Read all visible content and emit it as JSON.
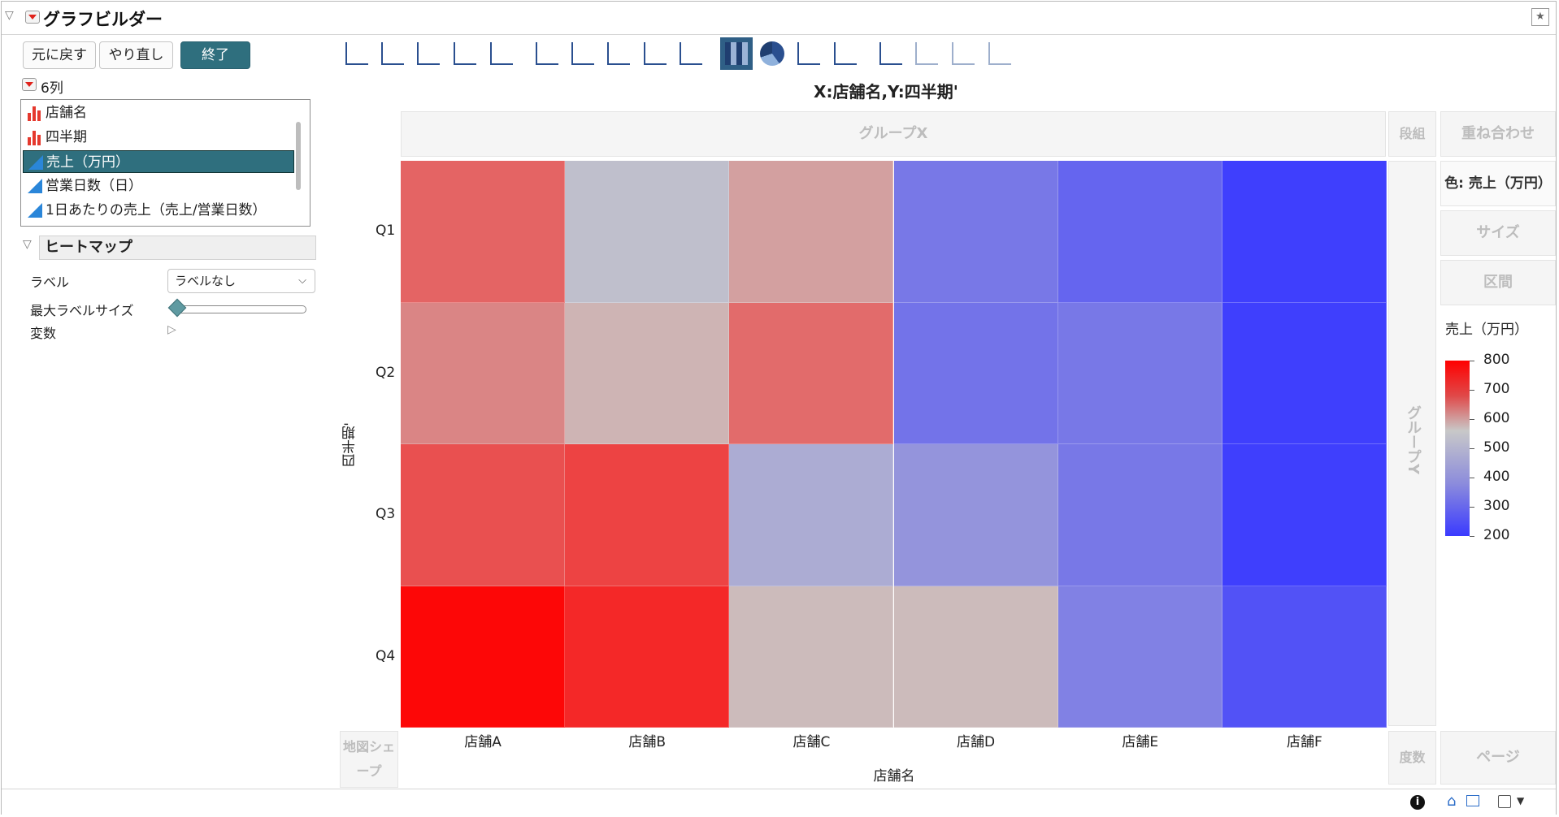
{
  "window": {
    "title": "グラフビルダー"
  },
  "buttons": {
    "undo": "元に戻す",
    "redo": "やり直し",
    "done": "終了"
  },
  "columns": {
    "count_label": "6列",
    "items": [
      {
        "label": "店舗名",
        "type": "nominal"
      },
      {
        "label": "四半期",
        "type": "nominal"
      },
      {
        "label": "売上（万円）",
        "type": "continuous",
        "selected": true
      },
      {
        "label": "営業日数（日）",
        "type": "continuous"
      },
      {
        "label": "1日あたりの売上（売上/営業日数）",
        "type": "continuous"
      }
    ]
  },
  "heatmap_panel": {
    "title": "ヒートマップ",
    "label_field": "ラベル",
    "label_value": "ラベルなし",
    "max_label_size": "最大ラベルサイズ",
    "variables": "変数"
  },
  "graph": {
    "title": "X:店舗名,Y:四半期'",
    "zones": {
      "group_x": "グループX",
      "group_y": "グループY",
      "wrap": "段組",
      "overlay": "重ね合わせ",
      "color": "色: 売上（万円）",
      "size": "サイズ",
      "interval": "区間",
      "map_shape": "地図シェープ",
      "freq": "度数",
      "page": "ページ"
    }
  },
  "chart_data": {
    "type": "heatmap",
    "title": "X:店舗名,Y:四半期'",
    "xlabel": "店舗名",
    "ylabel": "四半期'",
    "x_categories": [
      "店舗A",
      "店舗B",
      "店舗C",
      "店舗D",
      "店舗E",
      "店舗F"
    ],
    "y_categories": [
      "Q1",
      "Q2",
      "Q3",
      "Q4"
    ],
    "values": [
      [
        650,
        480,
        560,
        330,
        290,
        210
      ],
      [
        600,
        530,
        640,
        320,
        330,
        210
      ],
      [
        680,
        700,
        440,
        390,
        330,
        210
      ],
      [
        790,
        740,
        520,
        520,
        350,
        250
      ]
    ],
    "color_scale": {
      "title": "売上（万円）",
      "min": 200,
      "max": 800,
      "ticks": [
        800,
        700,
        600,
        500,
        400,
        300,
        200
      ],
      "colors": [
        "#ff0000",
        "#c8c8c8",
        "#3a3aff"
      ]
    },
    "legend": "right"
  },
  "icons": [
    "disclosure-triangle-icon",
    "red-menu-icon",
    "pin-icon",
    "info-icon",
    "home-icon"
  ]
}
